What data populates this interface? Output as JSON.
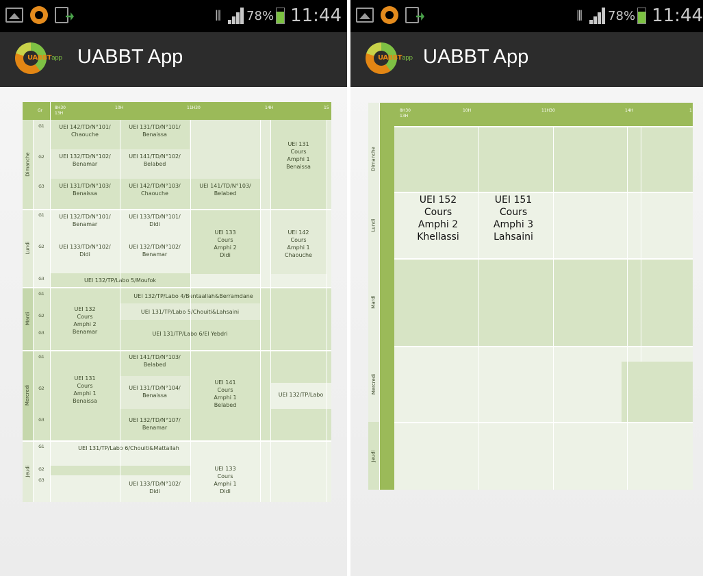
{
  "status_bar": {
    "battery_percent": "78%",
    "time": "11:44",
    "battery_color": "#7cc242"
  },
  "app_bar": {
    "title": "UABBT App",
    "logo_text": "UABBT",
    "logo_sub": "app"
  },
  "colors": {
    "header_green": "#9bba59",
    "row_dark": "#d4e1c2",
    "row_light": "#e9efe1",
    "actionbar": "#2c2c2c"
  },
  "left_table": {
    "header": {
      "gr": "Gr",
      "t1": "8H30",
      "t1b": "13H",
      "t2": "10H",
      "t3": "11H30",
      "t4": "14H",
      "t5": "15"
    },
    "days": {
      "dim": "Dimanche",
      "lun": "Lundi",
      "mar": "Mardi",
      "mer": "Mercredi",
      "jeu": "Jeudi"
    },
    "groups": {
      "g1": "G1",
      "g2": "G2",
      "g3": "G3"
    },
    "cells": {
      "dim_g1_c1": "UEI 142/TD/N°101/\nChaouche",
      "dim_g1_c2": "UEI 131/TD/N°101/\nBenaissa",
      "dim_g2_c1": "UEI 132/TD/N°102/\nBenamar",
      "dim_g2_c2": "UEI 141/TD/N°102/\nBelabed",
      "dim_g3_c1": "UEI 131/TD/N°103/\nBenaissa",
      "dim_g3_c2": "UEI 142/TD/N°103/\nChaouche",
      "dim_g3_c3": "UEI 141/TD/N°103/\nBelabed",
      "dim_c4": "UEI 131\nCours\nAmphi 1\nBenaissa",
      "lun_g1_c1": "UEI 132/TD/N°101/\nBenamar",
      "lun_g1_c2": "UEI 133/TD/N°101/\nDidi",
      "lun_g2_c1": "UEI 133/TD/N°102/\nDidi",
      "lun_g2_c2": "UEI 132/TD/N°102/\nBenamar",
      "lun_c3": "UEI 133\nCours\nAmphi 2\nDidi",
      "lun_c4": "UEI 142\nCours\nAmphi 1\nChaouche",
      "lun_g3": "UEI 132/TP/Labo 5/Moufok",
      "mar_c1": "UEI 132\nCours\nAmphi 2\nBenamar",
      "mar_g1": "UEI 132/TP/Labo 4/Bentaallah&Berramdane",
      "mar_g2": "UEI 131/TP/Labo 5/Chouiti&Lahsaini",
      "mar_g3": "UEI 131/TP/Labo 6/El Yebdri",
      "mer_c1": "UEI 131\nCours\nAmphi 1\nBenaissa",
      "mer_g1_c2": "UEI 141/TD/N°103/\nBelabed",
      "mer_g2_c2": "UEI 131/TD/N°104/\nBenaissa",
      "mer_g3_c2": "UEI 132/TD/N°107/\nBenamar",
      "mer_c3": "UEI 141\nCours\nAmphi 1\nBelabed",
      "mer_c5": "UEI 132/TP/Labo",
      "jeu_g1": "UEI 131/TP/Labo 6/Chouiti&Mattallah",
      "jeu_g3_c2": "UEI 133/TD/N°102/\nDidi",
      "jeu_c3": "UEI 133\nCours\nAmphi 1\nDidi"
    }
  },
  "right_table": {
    "header": {
      "t1": "8H30",
      "t1b": "13H",
      "t2": "10H",
      "t3": "11H30",
      "t4": "14H",
      "t5": "1"
    },
    "days": {
      "dim": "Dimanche",
      "lun": "Lundi",
      "mar": "Mardi",
      "mer": "Mercredi",
      "jeu": "Jeudi"
    },
    "cells": {
      "lun_c1": "UEI 152\nCours\nAmphi 2\nKhellassi",
      "lun_c2": "UEI 151\nCours\nAmphi 3\nLahsaini"
    }
  }
}
